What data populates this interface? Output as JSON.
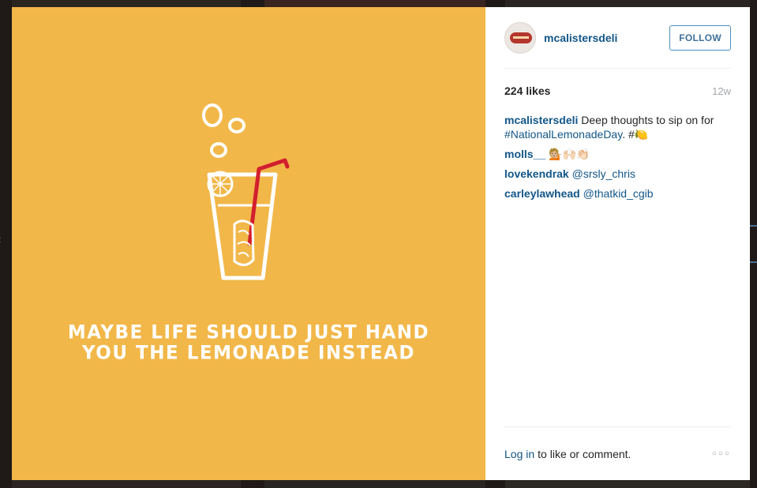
{
  "post": {
    "image_text": {
      "line1": "MAYBE LIFE SHOULD JUST HAND",
      "line2": "YOU THE LEMONADE INSTEAD"
    },
    "image_colors": {
      "background": "#f2b749",
      "straw": "#d2202e"
    }
  },
  "header": {
    "username": "mcalistersdeli",
    "follow_label": "FOLLOW"
  },
  "meta": {
    "likes": "224 likes",
    "age": "12w"
  },
  "comments": [
    {
      "author": "mcalistersdeli",
      "text": " Deep thoughts to sip on for ",
      "hashtag": "#NationalLemonadeDay",
      "suffix": ". #🍋"
    },
    {
      "author": "molls__",
      "text": " 💁🏼🙌🏻👏🏻"
    },
    {
      "author": "lovekendrak",
      "mention": " @srsly_chris"
    },
    {
      "author": "carleylawhead",
      "mention": " @thatkid_cgib"
    }
  ],
  "footer": {
    "login_label": "Log in",
    "prompt": "to like or comment.",
    "more_label": "○○○"
  },
  "nav": {
    "prev_icon": "‹"
  }
}
